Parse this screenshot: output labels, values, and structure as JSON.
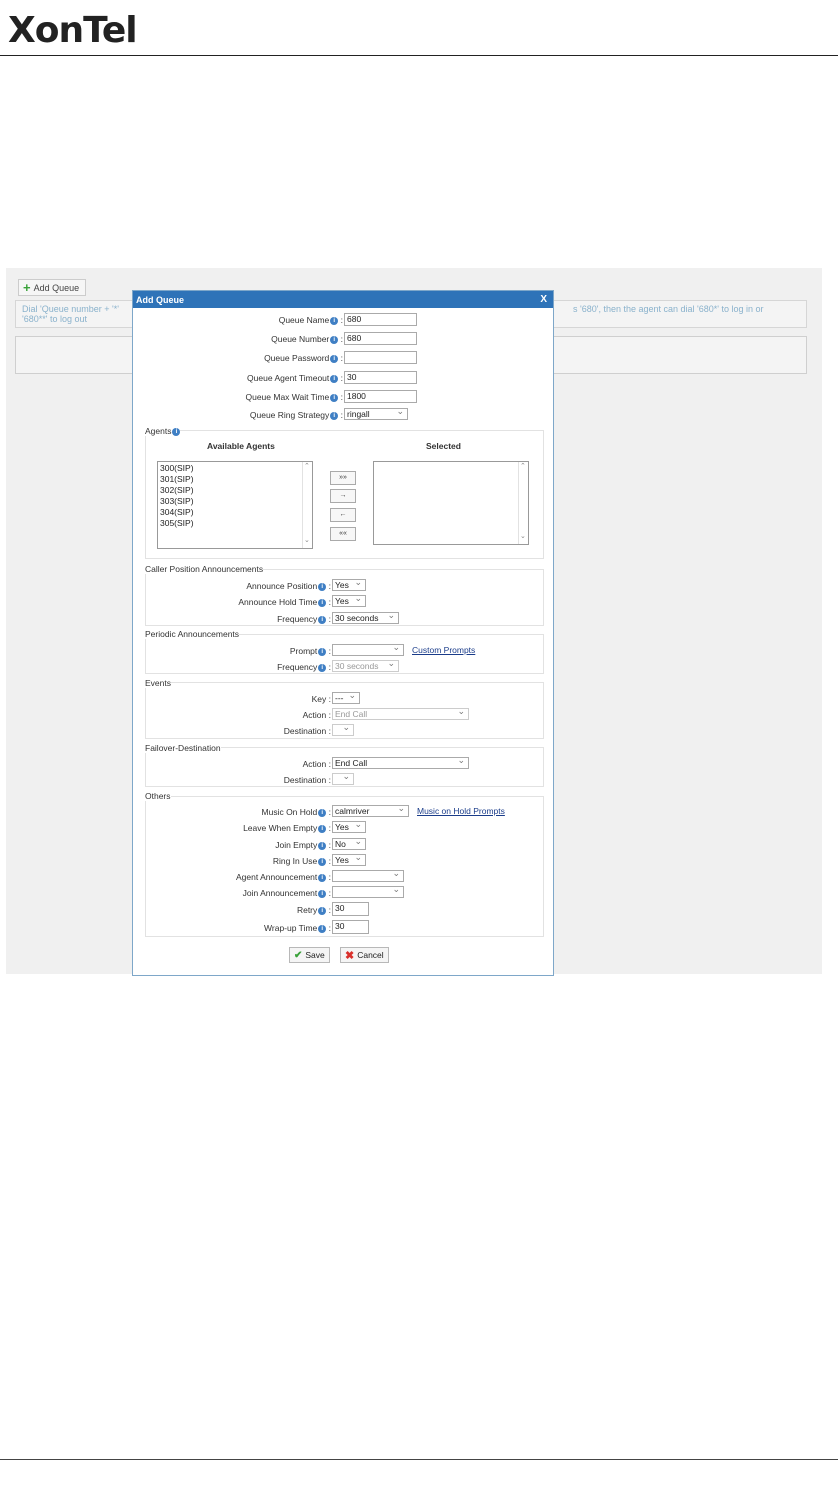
{
  "brand": {
    "logo_text": "XonTel"
  },
  "toolbar": {
    "add_queue_label": "Add Queue"
  },
  "note": {
    "line1_left": "Dial 'Queue number + '*'",
    "line1_right": "s '680', then the agent can dial '680*' to log in or",
    "line2": "'680**' to log out"
  },
  "dialog": {
    "title": "Add Queue",
    "close": "X",
    "fields": {
      "queue_name": {
        "label": "Queue Name",
        "value": "680"
      },
      "queue_number": {
        "label": "Queue Number",
        "value": "680"
      },
      "queue_password": {
        "label": "Queue Password",
        "value": ""
      },
      "agent_timeout": {
        "label": "Queue Agent Timeout",
        "value": "30"
      },
      "max_wait": {
        "label": "Queue Max Wait Time",
        "value": "1800"
      },
      "ring_strategy": {
        "label": "Queue Ring Strategy",
        "value": "ringall"
      }
    },
    "agents": {
      "legend": "Agents",
      "available_header": "Available Agents",
      "selected_header": "Selected",
      "available": [
        "300(SIP)",
        "301(SIP)",
        "302(SIP)",
        "303(SIP)",
        "304(SIP)",
        "305(SIP)"
      ],
      "buttons": {
        "add_all": "»»",
        "add": "→",
        "remove": "←",
        "remove_all": "««"
      }
    },
    "caller_position": {
      "legend": "Caller Position Announcements",
      "announce_position": {
        "label": "Announce Position",
        "value": "Yes"
      },
      "announce_hold_time": {
        "label": "Announce Hold Time",
        "value": "Yes"
      },
      "frequency": {
        "label": "Frequency",
        "value": "30 seconds"
      }
    },
    "periodic": {
      "legend": "Periodic Announcements",
      "prompt": {
        "label": "Prompt",
        "value": ""
      },
      "custom_prompts_link": "Custom Prompts",
      "frequency": {
        "label": "Frequency",
        "value": "30 seconds"
      }
    },
    "events": {
      "legend": "Events",
      "key": {
        "label": "Key",
        "value": "---"
      },
      "action": {
        "label": "Action",
        "value": "End Call"
      },
      "destination": {
        "label": "Destination",
        "value": ""
      }
    },
    "failover": {
      "legend": "Failover-Destination",
      "action": {
        "label": "Action",
        "value": "End Call"
      },
      "destination": {
        "label": "Destination",
        "value": ""
      }
    },
    "others": {
      "legend": "Others",
      "moh": {
        "label": "Music On Hold",
        "value": "calmriver"
      },
      "moh_link": "Music on Hold Prompts",
      "leave_when_empty": {
        "label": "Leave When Empty",
        "value": "Yes"
      },
      "join_empty": {
        "label": "Join Empty",
        "value": "No"
      },
      "ring_in_use": {
        "label": "Ring In Use",
        "value": "Yes"
      },
      "agent_announcement": {
        "label": "Agent Announcement",
        "value": ""
      },
      "join_announcement": {
        "label": "Join Announcement",
        "value": ""
      },
      "retry": {
        "label": "Retry",
        "value": "30"
      },
      "wrapup": {
        "label": "Wrap-up Time",
        "value": "30"
      }
    },
    "save_label": "Save",
    "cancel_label": "Cancel"
  }
}
